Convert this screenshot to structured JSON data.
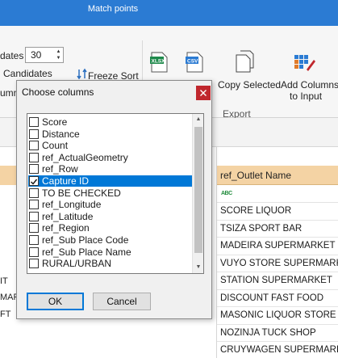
{
  "app": {
    "ribbon_tab": "Match points"
  },
  "ribbon": {
    "candidates_label_1": "dates",
    "candidates_value": "30",
    "candidates_label_2": "Candidates",
    "col_label": "umn",
    "freeze_sort": "Freeze Sort",
    "copy_selected": "Copy Selected",
    "add_columns_line1": "Add Columns",
    "add_columns_line2": "to Input",
    "export_group": "Export",
    "xlsx_label": "XLSX",
    "csv_label": "CSV"
  },
  "grid": {
    "left_cells": [
      "IT",
      "MAR",
      "FT"
    ],
    "column_header": "ref_Outlet Name",
    "column_type_icon": "ABC",
    "rows": [
      "SCORE LIQUOR",
      "TSIZA SPORT BAR",
      "MADEIRA SUPERMARKET",
      "VUYO STORE SUPERMARKET",
      "STATION SUPERMARKET",
      "DISCOUNT FAST FOOD",
      "MASONIC LIQUOR STORE",
      "NOZINJA TUCK SHOP",
      "CRUYWAGEN SUPERMARKET"
    ]
  },
  "dialog": {
    "title": "Choose columns",
    "close_icon": "close-icon",
    "items": [
      {
        "label": "Score",
        "checked": false,
        "selected": false
      },
      {
        "label": "Distance",
        "checked": false,
        "selected": false
      },
      {
        "label": "Count",
        "checked": false,
        "selected": false
      },
      {
        "label": "ref_ActualGeometry",
        "checked": false,
        "selected": false
      },
      {
        "label": "ref_Row",
        "checked": false,
        "selected": false
      },
      {
        "label": "Capture ID",
        "checked": true,
        "selected": true
      },
      {
        "label": "TO BE CHECKED",
        "checked": false,
        "selected": false
      },
      {
        "label": "ref_Longitude",
        "checked": false,
        "selected": false
      },
      {
        "label": "ref_Latitude",
        "checked": false,
        "selected": false
      },
      {
        "label": "ref_Region",
        "checked": false,
        "selected": false
      },
      {
        "label": "ref_Sub Place Code",
        "checked": false,
        "selected": false
      },
      {
        "label": "ref_Sub Place Name",
        "checked": false,
        "selected": false
      },
      {
        "label": "RURAL/URBAN",
        "checked": false,
        "selected": false
      }
    ],
    "ok_label": "OK",
    "cancel_label": "Cancel"
  },
  "colors": {
    "title_bar": "#2b7bd3",
    "column_header": "#f4d3a4",
    "selection": "#0078d7",
    "close_button": "#c0272d"
  }
}
